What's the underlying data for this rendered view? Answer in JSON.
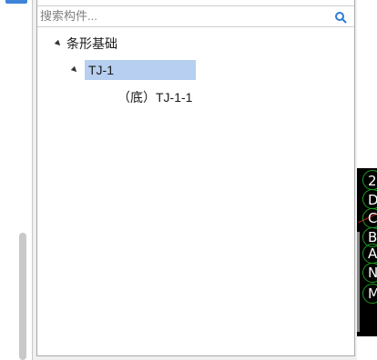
{
  "search": {
    "placeholder": "搜索构件..."
  },
  "tree": {
    "root": {
      "label": "条形基础",
      "expanded": true
    },
    "child": {
      "label": "TJ-1",
      "expanded": true,
      "selected": true
    },
    "leaf": {
      "label": "（底）TJ-1-1"
    }
  },
  "canvas_labels": [
    "2",
    "D",
    "C",
    "B",
    "A",
    "N",
    "M"
  ],
  "colors": {
    "selection": "#b7cff0",
    "node_outline": "#1e9a1e",
    "axis_red": "#d02020"
  },
  "icons": {
    "search": "search-icon",
    "expand": "expand-triangle-icon"
  }
}
